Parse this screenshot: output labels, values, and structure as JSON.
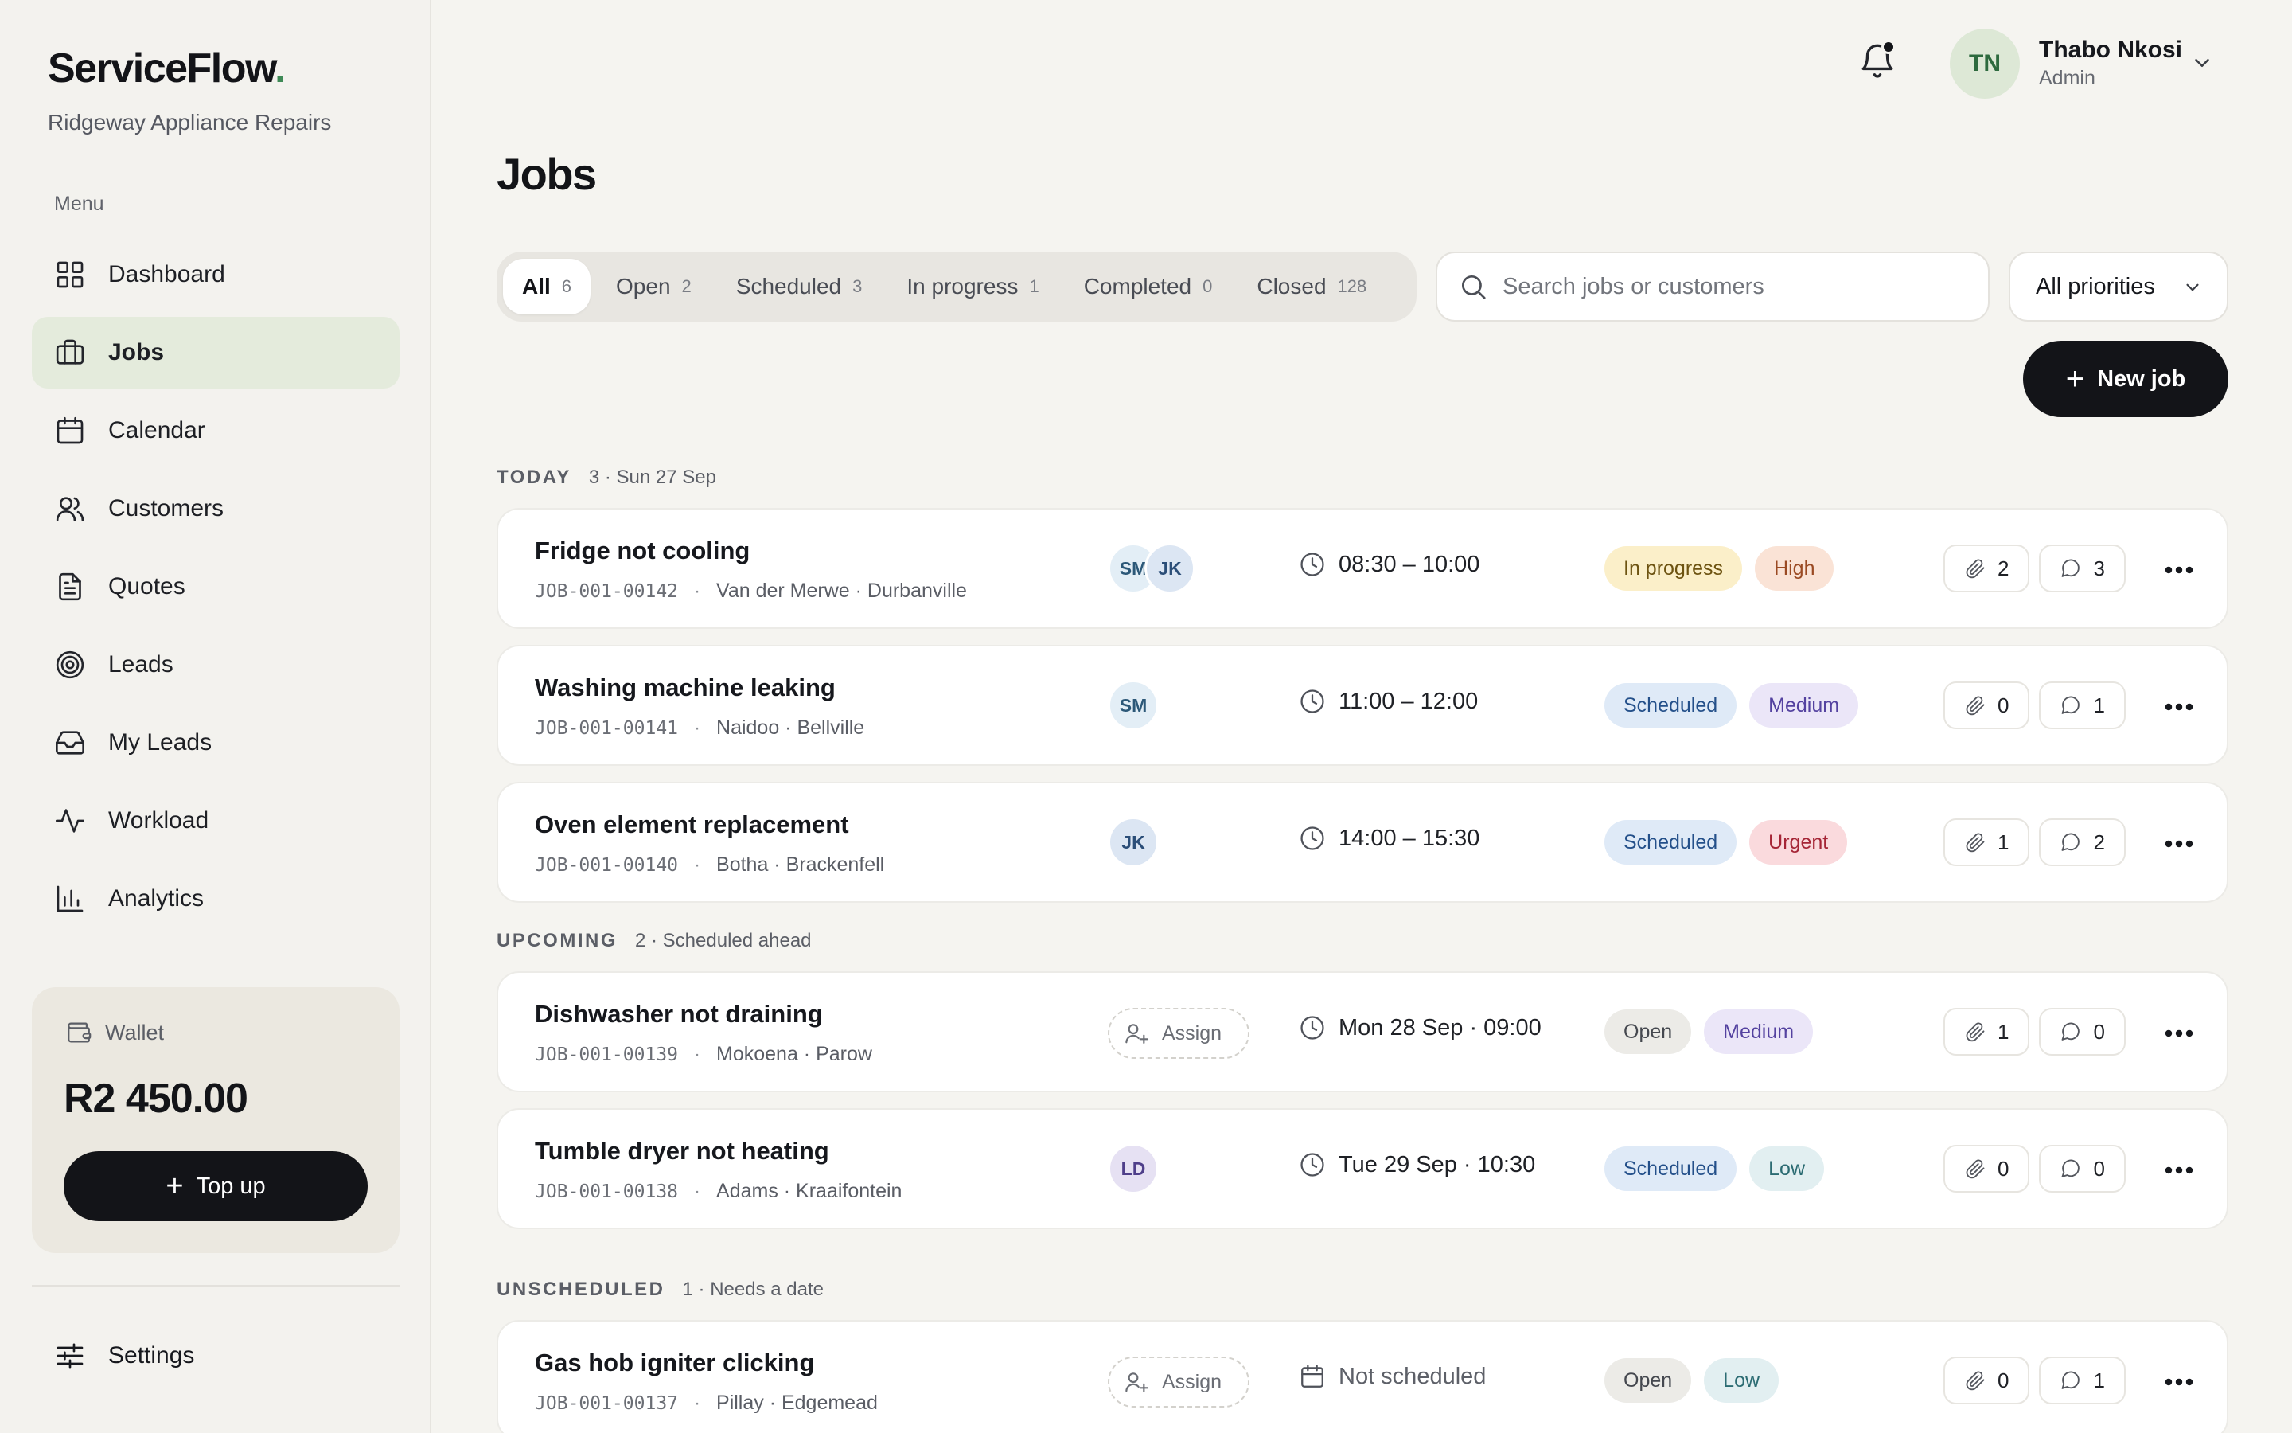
{
  "brand": {
    "name": "ServiceFlow",
    "dot": ".",
    "subtitle": "Ridgeway Appliance Repairs"
  },
  "sidebar": {
    "menu_label": "Menu",
    "items": [
      {
        "label": "Dashboard",
        "icon": "dashboard-icon",
        "active": false
      },
      {
        "label": "Jobs",
        "icon": "briefcase-icon",
        "active": true
      },
      {
        "label": "Calendar",
        "icon": "calendar-icon",
        "active": false
      },
      {
        "label": "Customers",
        "icon": "users-icon",
        "active": false
      },
      {
        "label": "Quotes",
        "icon": "document-icon",
        "active": false
      },
      {
        "label": "Leads",
        "icon": "target-icon",
        "active": false
      },
      {
        "label": "My Leads",
        "icon": "inbox-icon",
        "active": false
      },
      {
        "label": "Workload",
        "icon": "activity-icon",
        "active": false
      },
      {
        "label": "Analytics",
        "icon": "bar-chart-icon",
        "active": false
      }
    ],
    "wallet": {
      "label": "Wallet",
      "amount": "R2 450.00",
      "button": "Top up"
    },
    "settings_label": "Settings"
  },
  "header": {
    "user": {
      "initials": "TN",
      "name": "Thabo Nkosi",
      "role": "Admin"
    },
    "notifications_badge": true
  },
  "page": {
    "title": "Jobs"
  },
  "filters": {
    "tabs": [
      {
        "label": "All",
        "count": "6",
        "active": true
      },
      {
        "label": "Open",
        "count": "2",
        "active": false
      },
      {
        "label": "Scheduled",
        "count": "3",
        "active": false
      },
      {
        "label": "In progress",
        "count": "1",
        "active": false
      },
      {
        "label": "Completed",
        "count": "0",
        "active": false
      },
      {
        "label": "Closed",
        "count": "128",
        "active": false
      }
    ],
    "search_placeholder": "Search jobs or customers",
    "priority_selected": "All priorities",
    "new_job_label": "New job"
  },
  "sections": [
    {
      "name": "TODAY",
      "meta": "3 · Sun 27 Sep",
      "jobs": [
        {
          "title": "Fridge not cooling",
          "id": "JOB-001-00142",
          "customer": "Van der Merwe · Durbanville",
          "assignees": [
            "SM",
            "JK"
          ],
          "time": "08:30 – 10:00",
          "time_icon": "clock-icon",
          "status": "In progress",
          "status_class": "st-progress",
          "priority": "High",
          "priority_class": "pr-high",
          "attachments": "2",
          "comments": "3"
        },
        {
          "title": "Washing machine leaking",
          "id": "JOB-001-00141",
          "customer": "Naidoo · Bellville",
          "assignees": [
            "SM"
          ],
          "time": "11:00 – 12:00",
          "time_icon": "clock-icon",
          "status": "Scheduled",
          "status_class": "st-scheduled",
          "priority": "Medium",
          "priority_class": "pr-medium",
          "attachments": "0",
          "comments": "1"
        },
        {
          "title": "Oven element replacement",
          "id": "JOB-001-00140",
          "customer": "Botha · Brackenfell",
          "assignees": [
            "JK"
          ],
          "time": "14:00 – 15:30",
          "time_icon": "clock-icon",
          "status": "Scheduled",
          "status_class": "st-scheduled",
          "priority": "Urgent",
          "priority_class": "pr-urgent",
          "attachments": "1",
          "comments": "2"
        }
      ]
    },
    {
      "name": "UPCOMING",
      "meta": "2 · Scheduled ahead",
      "jobs": [
        {
          "title": "Dishwasher not draining",
          "id": "JOB-001-00139",
          "customer": "Mokoena · Parow",
          "assignees": [],
          "assign_label": "Assign",
          "time": "Mon 28 Sep · 09:00",
          "time_icon": "clock-icon",
          "status": "Open",
          "status_class": "st-open",
          "priority": "Medium",
          "priority_class": "pr-medium",
          "attachments": "1",
          "comments": "0"
        },
        {
          "title": "Tumble dryer not heating",
          "id": "JOB-001-00138",
          "customer": "Adams · Kraaifontein",
          "assignees": [
            "LD"
          ],
          "time": "Tue 29 Sep · 10:30",
          "time_icon": "clock-icon",
          "status": "Scheduled",
          "status_class": "st-scheduled",
          "priority": "Low",
          "priority_class": "pr-low",
          "attachments": "0",
          "comments": "0"
        }
      ]
    },
    {
      "name": "UNSCHEDULED",
      "meta": "1 · Needs a date",
      "jobs": [
        {
          "title": "Gas hob igniter clicking",
          "id": "JOB-001-00137",
          "customer": "Pillay · Edgemead",
          "assignees": [],
          "assign_label": "Assign",
          "time": "Not scheduled",
          "time_icon": "calendar-icon",
          "status": "Open",
          "status_class": "st-open",
          "priority": "Low",
          "priority_class": "pr-low",
          "attachments": "0",
          "comments": "1"
        }
      ]
    }
  ]
}
